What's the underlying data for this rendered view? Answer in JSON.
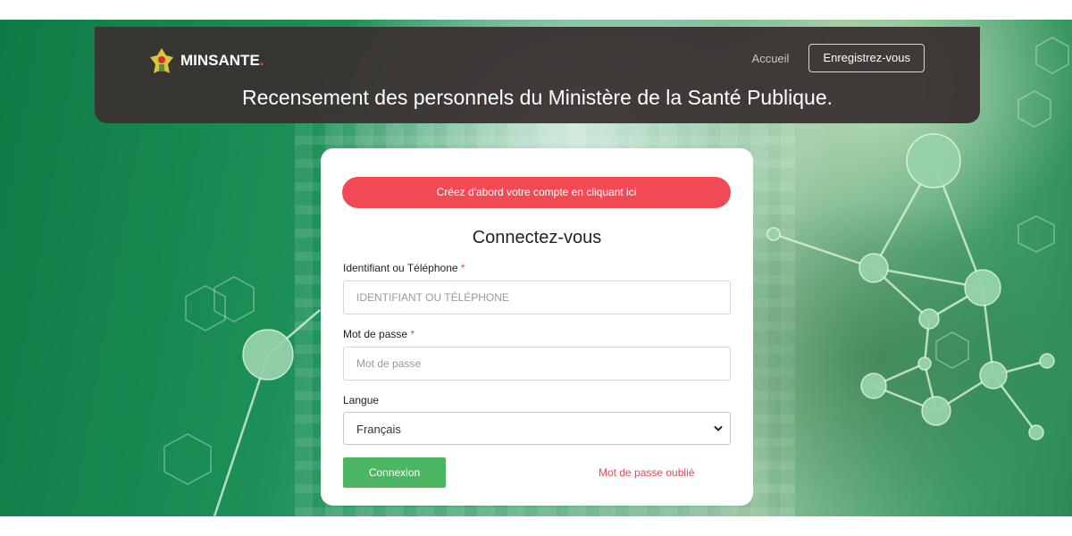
{
  "header": {
    "logo_text": "MINSANTE",
    "logo_dot": ".",
    "nav_home": "Accueil",
    "nav_register": "Enregistrez-vous",
    "site_title": "Recensement des personnels du Ministère de la Santé Publique."
  },
  "login_card": {
    "create_account_banner": "Créez d'abord votre compte en cliquant ici",
    "title": "Connectez-vous",
    "identifier_label": "Identifiant ou Téléphone",
    "identifier_placeholder": "IDENTIFIANT OU TÉLÉPHONE",
    "identifier_value": "",
    "password_label": "Mot de passe",
    "password_placeholder": "Mot de passe",
    "password_value": "",
    "language_label": "Langue",
    "language_selected": "Français",
    "required_marker": "*",
    "login_button": "Connexion",
    "forgot_password_link": "Mot de passe oublié"
  },
  "icons": {
    "logo": "ministry-emblem-icon",
    "select_arrow": "chevron-down-icon"
  },
  "colors": {
    "accent_red": "#f24a54",
    "login_green": "#4cb763",
    "header_bg": "#3a3232"
  }
}
